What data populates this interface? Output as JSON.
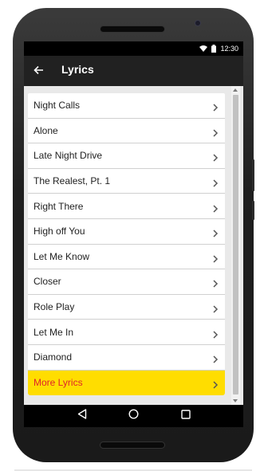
{
  "status_bar": {
    "time": "12:30"
  },
  "app_bar": {
    "title": "Lyrics"
  },
  "list": {
    "items": [
      {
        "label": "Night Calls"
      },
      {
        "label": "Alone"
      },
      {
        "label": "Late Night Drive"
      },
      {
        "label": "The Realest, Pt. 1"
      },
      {
        "label": "Right There"
      },
      {
        "label": "High off You"
      },
      {
        "label": "Let Me Know"
      },
      {
        "label": "Closer"
      },
      {
        "label": "Role Play"
      },
      {
        "label": "Let Me In"
      },
      {
        "label": "Diamond"
      }
    ],
    "more": {
      "label": "More Lyrics"
    }
  },
  "colors": {
    "app_bar": "#212121",
    "more_background": "#ffdd00",
    "more_text": "#e0242b"
  },
  "icons": {
    "back": "arrow-left-icon",
    "chevron": "chevron-right-icon",
    "nav_back": "triangle-back-icon",
    "nav_home": "circle-home-icon",
    "nav_recents": "square-recents-icon"
  }
}
